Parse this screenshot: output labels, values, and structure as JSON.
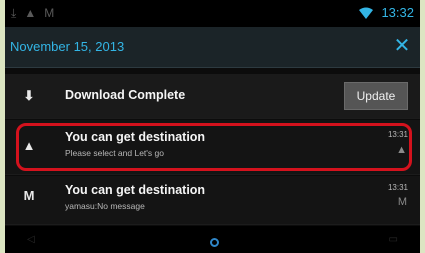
{
  "status_bar": {
    "left_icons": [
      "download-icon",
      "navigation-icon",
      "gmail-icon"
    ],
    "time": "13:32",
    "accent_color": "#33b5e5"
  },
  "header": {
    "date": "November 15, 2013",
    "close_icon": "close-icon"
  },
  "notifications": [
    {
      "icon": "download-complete-icon",
      "title": "Download Complete",
      "button_label": "Update"
    },
    {
      "icon": "navigation-icon",
      "title": "You can get destination",
      "subtitle": "Please select and Let's go",
      "time": "13:31",
      "highlighted": true,
      "highlight_color": "#d4121d"
    },
    {
      "icon": "gmail-icon",
      "title": "You can get destination",
      "subtitle": "yamasu:No message",
      "time": "13:31"
    }
  ]
}
